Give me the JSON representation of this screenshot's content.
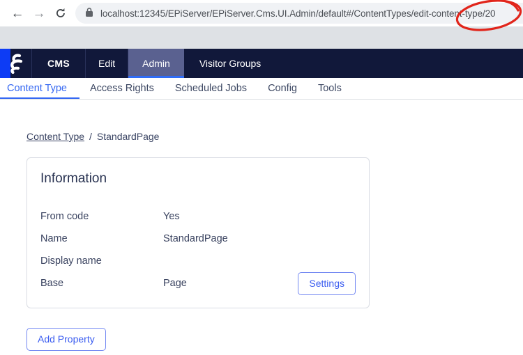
{
  "browser": {
    "icons": {
      "back": "←",
      "forward": "→"
    },
    "url": "localhost:12345/EPiServer/EPiServer.Cms.UI.Admin/default#/ContentTypes/edit-content-type/20"
  },
  "top_nav": {
    "items": [
      {
        "label": "CMS",
        "active": false
      },
      {
        "label": "Edit",
        "active": false
      },
      {
        "label": "Admin",
        "active": true
      },
      {
        "label": "Visitor Groups",
        "active": false
      }
    ]
  },
  "sub_nav": {
    "items": [
      {
        "label": "Content Type",
        "active": true
      },
      {
        "label": "Access Rights",
        "active": false
      },
      {
        "label": "Scheduled Jobs",
        "active": false
      },
      {
        "label": "Config",
        "active": false
      },
      {
        "label": "Tools",
        "active": false
      }
    ]
  },
  "breadcrumb": {
    "link": "Content Type",
    "separator": "/",
    "current": "StandardPage"
  },
  "info_card": {
    "title": "Information",
    "rows": [
      {
        "label": "From code",
        "value": "Yes"
      },
      {
        "label": "Name",
        "value": "StandardPage"
      },
      {
        "label": "Display name",
        "value": ""
      },
      {
        "label": "Base",
        "value": "Page"
      }
    ],
    "settings_button": "Settings"
  },
  "actions": {
    "add_property": "Add Property"
  },
  "colors": {
    "navy": "#11183a",
    "active_tab_bg": "#5a6190",
    "accent_blue": "#2f6cf6",
    "logo_blue": "#0d3cf5",
    "link_blue": "#3467f2",
    "annotation_red": "#e1251b",
    "chrome_band": "#dee1e5",
    "url_pill": "#f0f2f5"
  }
}
